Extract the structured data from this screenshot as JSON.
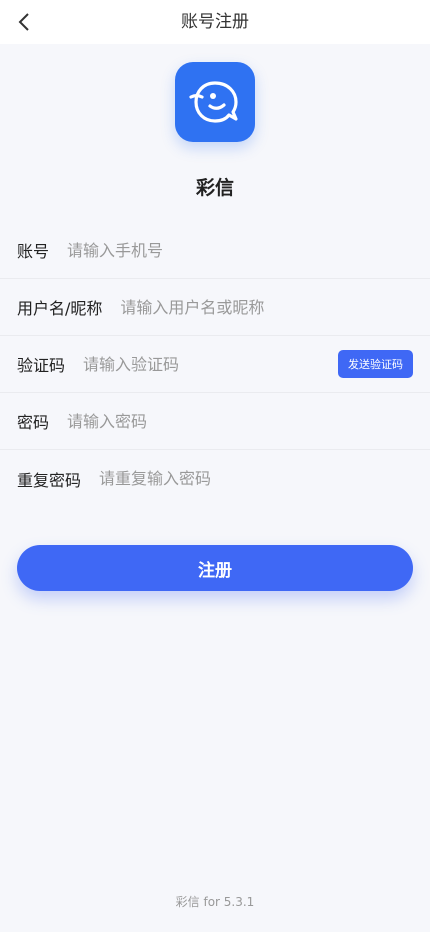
{
  "header": {
    "title": "账号注册",
    "back_icon": "chevron-left-icon"
  },
  "app": {
    "name": "彩信",
    "logo_icon": "bird-chat-logo",
    "brand_color": "#2f72f2"
  },
  "form": {
    "account": {
      "label": "账号",
      "placeholder": "请输入手机号",
      "value": ""
    },
    "username": {
      "label": "用户名/昵称",
      "placeholder": "请输入用户名或昵称",
      "value": ""
    },
    "code": {
      "label": "验证码",
      "placeholder": "请输入验证码",
      "value": "",
      "send_label": "发送验证码"
    },
    "password": {
      "label": "密码",
      "placeholder": "请输入密码",
      "value": ""
    },
    "confirm_password": {
      "label": "重复密码",
      "placeholder": "请重复输入密码",
      "value": ""
    }
  },
  "register_button": {
    "label": "注册",
    "color": "#3f68f5"
  },
  "footer": {
    "version": "彩信 for 5.3.1"
  }
}
